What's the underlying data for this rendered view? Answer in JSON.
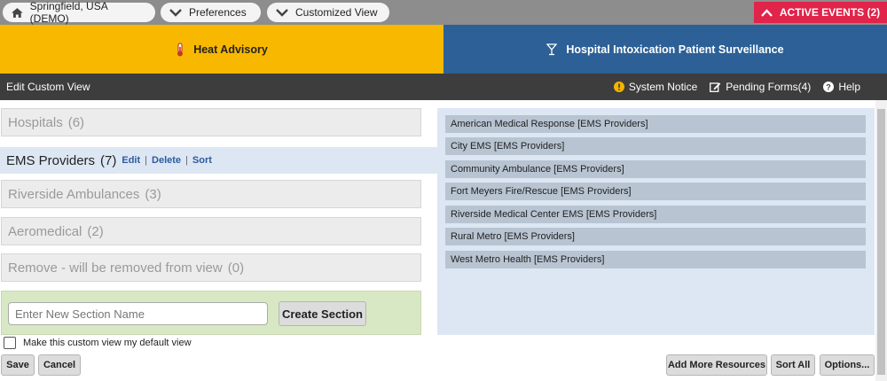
{
  "topbar": {
    "location": "Springfield, USA (DEMO)",
    "preferences": "Preferences",
    "customized_view": "Customized View",
    "active_events": "ACTIVE EVENTS (2)"
  },
  "banners": {
    "left": "Heat Advisory",
    "right": "Hospital Intoxication Patient Surveillance"
  },
  "subheader": {
    "title": "Edit Custom View",
    "system_notice": "System Notice",
    "pending_forms": "Pending Forms(4)",
    "help": "Help"
  },
  "sections": [
    {
      "name": "Hospitals",
      "count": "(6)"
    },
    {
      "name": "EMS Providers",
      "count": "(7)",
      "edit": "Edit",
      "delete": "Delete",
      "sort": "Sort"
    },
    {
      "name": "Riverside Ambulances",
      "count": "(3)"
    },
    {
      "name": "Aeromedical",
      "count": "(2)"
    },
    {
      "name": "Remove - will be removed from view",
      "count": "(0)"
    }
  ],
  "new_section": {
    "placeholder": "Enter New Section Name",
    "value": "",
    "create_label": "Create Section"
  },
  "resources": [
    "American Medical Response [EMS Providers]",
    "City EMS [EMS Providers]",
    "Community Ambulance [EMS Providers]",
    "Fort Meyers Fire/Rescue [EMS Providers]",
    "Riverside Medical Center EMS [EMS Providers]",
    "Rural Metro [EMS Providers]",
    "West Metro Health [EMS Providers]"
  ],
  "default_view": {
    "label": "Make this custom view my default view",
    "checked": false
  },
  "buttons": {
    "save": "Save",
    "cancel": "Cancel",
    "add_more": "Add More Resources",
    "sort_all": "Sort All",
    "options": "Options..."
  },
  "colors": {
    "active_events": "#e0244a",
    "heat_banner": "#f9b800",
    "surveillance_banner": "#2c6096",
    "selected_section": "#dde7f3",
    "new_section_panel": "#d9e8c4",
    "link": "#2c5aa0"
  }
}
